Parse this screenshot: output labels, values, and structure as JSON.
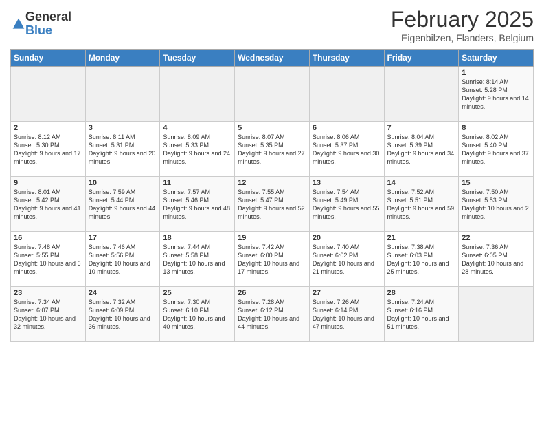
{
  "logo": {
    "general": "General",
    "blue": "Blue"
  },
  "title": "February 2025",
  "subtitle": "Eigenbilzen, Flanders, Belgium",
  "headers": [
    "Sunday",
    "Monday",
    "Tuesday",
    "Wednesday",
    "Thursday",
    "Friday",
    "Saturday"
  ],
  "weeks": [
    [
      {
        "day": "",
        "info": ""
      },
      {
        "day": "",
        "info": ""
      },
      {
        "day": "",
        "info": ""
      },
      {
        "day": "",
        "info": ""
      },
      {
        "day": "",
        "info": ""
      },
      {
        "day": "",
        "info": ""
      },
      {
        "day": "1",
        "info": "Sunrise: 8:14 AM\nSunset: 5:28 PM\nDaylight: 9 hours\nand 14 minutes."
      }
    ],
    [
      {
        "day": "2",
        "info": "Sunrise: 8:12 AM\nSunset: 5:30 PM\nDaylight: 9 hours\nand 17 minutes."
      },
      {
        "day": "3",
        "info": "Sunrise: 8:11 AM\nSunset: 5:31 PM\nDaylight: 9 hours\nand 20 minutes."
      },
      {
        "day": "4",
        "info": "Sunrise: 8:09 AM\nSunset: 5:33 PM\nDaylight: 9 hours\nand 24 minutes."
      },
      {
        "day": "5",
        "info": "Sunrise: 8:07 AM\nSunset: 5:35 PM\nDaylight: 9 hours\nand 27 minutes."
      },
      {
        "day": "6",
        "info": "Sunrise: 8:06 AM\nSunset: 5:37 PM\nDaylight: 9 hours\nand 30 minutes."
      },
      {
        "day": "7",
        "info": "Sunrise: 8:04 AM\nSunset: 5:39 PM\nDaylight: 9 hours\nand 34 minutes."
      },
      {
        "day": "8",
        "info": "Sunrise: 8:02 AM\nSunset: 5:40 PM\nDaylight: 9 hours\nand 37 minutes."
      }
    ],
    [
      {
        "day": "9",
        "info": "Sunrise: 8:01 AM\nSunset: 5:42 PM\nDaylight: 9 hours\nand 41 minutes."
      },
      {
        "day": "10",
        "info": "Sunrise: 7:59 AM\nSunset: 5:44 PM\nDaylight: 9 hours\nand 44 minutes."
      },
      {
        "day": "11",
        "info": "Sunrise: 7:57 AM\nSunset: 5:46 PM\nDaylight: 9 hours\nand 48 minutes."
      },
      {
        "day": "12",
        "info": "Sunrise: 7:55 AM\nSunset: 5:47 PM\nDaylight: 9 hours\nand 52 minutes."
      },
      {
        "day": "13",
        "info": "Sunrise: 7:54 AM\nSunset: 5:49 PM\nDaylight: 9 hours\nand 55 minutes."
      },
      {
        "day": "14",
        "info": "Sunrise: 7:52 AM\nSunset: 5:51 PM\nDaylight: 9 hours\nand 59 minutes."
      },
      {
        "day": "15",
        "info": "Sunrise: 7:50 AM\nSunset: 5:53 PM\nDaylight: 10 hours\nand 2 minutes."
      }
    ],
    [
      {
        "day": "16",
        "info": "Sunrise: 7:48 AM\nSunset: 5:55 PM\nDaylight: 10 hours\nand 6 minutes."
      },
      {
        "day": "17",
        "info": "Sunrise: 7:46 AM\nSunset: 5:56 PM\nDaylight: 10 hours\nand 10 minutes."
      },
      {
        "day": "18",
        "info": "Sunrise: 7:44 AM\nSunset: 5:58 PM\nDaylight: 10 hours\nand 13 minutes."
      },
      {
        "day": "19",
        "info": "Sunrise: 7:42 AM\nSunset: 6:00 PM\nDaylight: 10 hours\nand 17 minutes."
      },
      {
        "day": "20",
        "info": "Sunrise: 7:40 AM\nSunset: 6:02 PM\nDaylight: 10 hours\nand 21 minutes."
      },
      {
        "day": "21",
        "info": "Sunrise: 7:38 AM\nSunset: 6:03 PM\nDaylight: 10 hours\nand 25 minutes."
      },
      {
        "day": "22",
        "info": "Sunrise: 7:36 AM\nSunset: 6:05 PM\nDaylight: 10 hours\nand 28 minutes."
      }
    ],
    [
      {
        "day": "23",
        "info": "Sunrise: 7:34 AM\nSunset: 6:07 PM\nDaylight: 10 hours\nand 32 minutes."
      },
      {
        "day": "24",
        "info": "Sunrise: 7:32 AM\nSunset: 6:09 PM\nDaylight: 10 hours\nand 36 minutes."
      },
      {
        "day": "25",
        "info": "Sunrise: 7:30 AM\nSunset: 6:10 PM\nDaylight: 10 hours\nand 40 minutes."
      },
      {
        "day": "26",
        "info": "Sunrise: 7:28 AM\nSunset: 6:12 PM\nDaylight: 10 hours\nand 44 minutes."
      },
      {
        "day": "27",
        "info": "Sunrise: 7:26 AM\nSunset: 6:14 PM\nDaylight: 10 hours\nand 47 minutes."
      },
      {
        "day": "28",
        "info": "Sunrise: 7:24 AM\nSunset: 6:16 PM\nDaylight: 10 hours\nand 51 minutes."
      },
      {
        "day": "",
        "info": ""
      }
    ]
  ]
}
